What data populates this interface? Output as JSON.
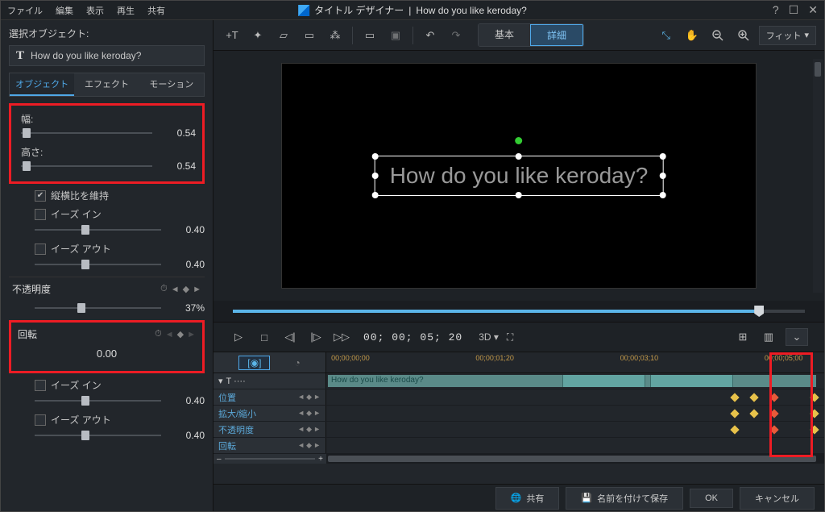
{
  "menu": {
    "file": "ファイル",
    "edit": "編集",
    "view": "表示",
    "play": "再生",
    "share": "共有"
  },
  "title": {
    "app": "タイトル デザイナー",
    "sep": "|",
    "doc": "How do you like keroday?"
  },
  "win": {
    "help": "?",
    "max": "☐",
    "close": "✕"
  },
  "left": {
    "select_label": "選択オブジェクト:",
    "selected_text": "How do you like keroday?",
    "tabs": {
      "object": "オブジェクト",
      "effect": "エフェクト",
      "motion": "モーション"
    },
    "width": {
      "label": "幅:",
      "value": "0.54"
    },
    "height": {
      "label": "高さ:",
      "value": "0.54"
    },
    "keep_aspect": "縦横比を維持",
    "ease_in": "イーズ イン",
    "ease_in_val": "0.40",
    "ease_out": "イーズ アウト",
    "ease_out_val": "0.40",
    "opacity": {
      "label": "不透明度",
      "value": "37%"
    },
    "rotation": {
      "label": "回転",
      "value": "0.00"
    },
    "ease_in2_val": "0.40",
    "ease_out2_val": "0.40"
  },
  "toolbar": {
    "basic": "基本",
    "advanced": "詳細",
    "zoom": "フィット"
  },
  "preview": {
    "text": "How do you like keroday?"
  },
  "transport": {
    "timecode": "00; 00; 05; 20",
    "mode3d": "3D"
  },
  "timeline": {
    "marks": [
      "00;00;00;00",
      "00;00;01;20",
      "00;00;03;10",
      "00;00;05;00"
    ],
    "clip_text": "How do you like keroday?",
    "rows": {
      "position": "位置",
      "scale": "拡大/縮小",
      "opacity": "不透明度",
      "rotation": "回転"
    }
  },
  "footer": {
    "share": "共有",
    "save_as": "名前を付けて保存",
    "ok": "OK",
    "cancel": "キャンセル"
  }
}
